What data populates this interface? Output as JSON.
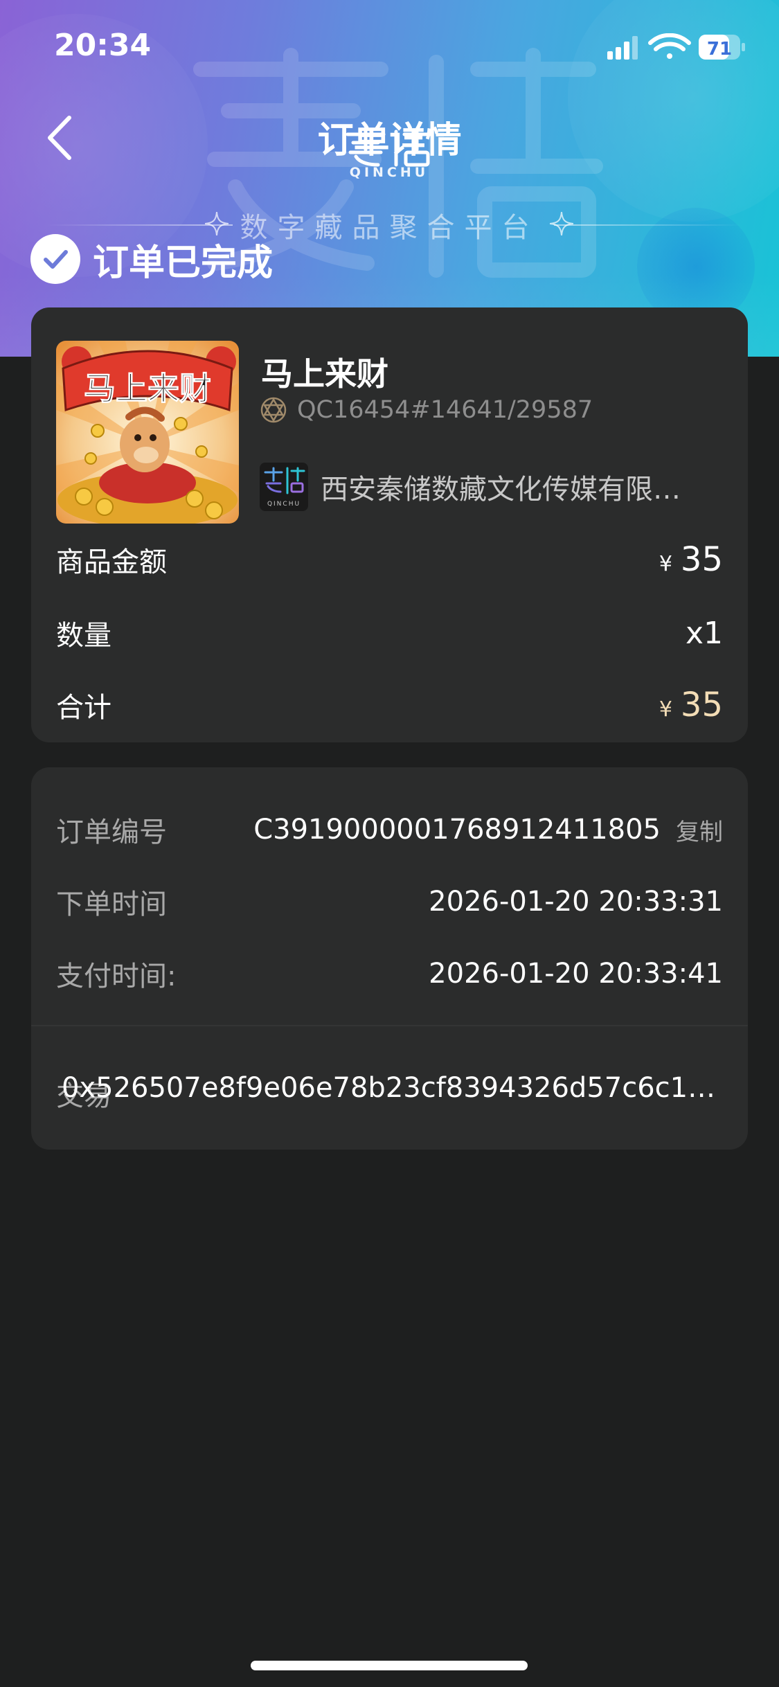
{
  "status_bar": {
    "time": "20:34",
    "battery": "71",
    "icons": [
      "signal-icon",
      "wifi-icon",
      "battery-icon"
    ]
  },
  "nav": {
    "title": "订单详情",
    "back_icon": "chevron-left-icon"
  },
  "banner": {
    "brand_latin": "QINCHU",
    "tagline": "数字藏品聚合平台"
  },
  "order_status": {
    "text": "订单已完成",
    "icon": "check-circle-icon"
  },
  "product": {
    "image_caption": "马上来财",
    "name": "马上来财",
    "chain_id": "QC16454#14641/29587",
    "issuer_name": "西安秦储数藏文化传媒有限…",
    "issuer_logo_text": "QINCHU"
  },
  "pricing": {
    "amount_label": "商品金额",
    "amount_currency": "¥",
    "amount_value": "35",
    "qty_label": "数量",
    "qty_value": "x1",
    "total_label": "合计",
    "total_currency": "¥",
    "total_value": "35"
  },
  "order_info": {
    "order_no_label": "订单编号",
    "order_no_value": "C391900000176891241180​5",
    "copy_label": "复制",
    "created_label": "下单时间",
    "created_value": "2026-01-20 20:33:31",
    "paid_label": "支付时间:",
    "paid_value": "2026-01-20 20:33:41",
    "tx_label": "交易",
    "tx_value": "0x526507e8f9e06e78b23cf8394326d57c6c19…"
  },
  "colors": {
    "page_bg": "#1e1f1f",
    "card_bg": "#2b2c2c",
    "muted_text": "#a9a9a9",
    "gold_total": "#f3ddb6",
    "gradient_start": "#8a63d6",
    "gradient_end": "#18c3d6"
  }
}
